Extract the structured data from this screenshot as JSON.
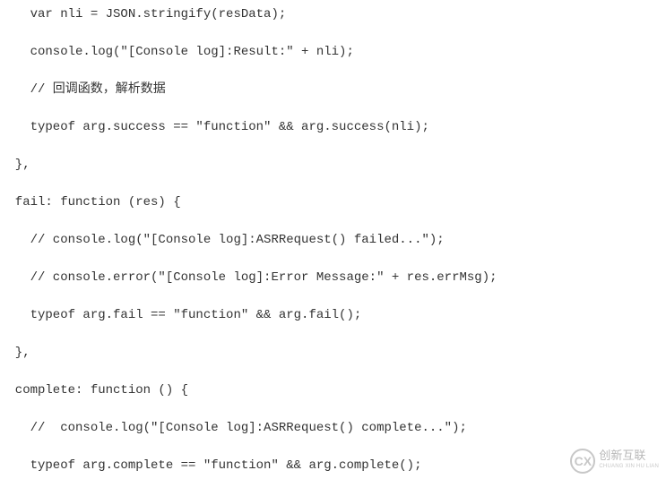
{
  "code": {
    "lines": [
      "    var nli = JSON.stringify(resData);",
      "",
      "    console.log(\"[Console log]:Result:\" + nli);",
      "",
      "    // 回调函数，解析数据",
      "",
      "    typeof arg.success == \"function\" && arg.success(nli);",
      "",
      "  },",
      "",
      "  fail: function (res) {",
      "",
      "    // console.log(\"[Console log]:ASRRequest() failed...\");",
      "",
      "    // console.error(\"[Console log]:Error Message:\" + res.errMsg);",
      "",
      "    typeof arg.fail == \"function\" && arg.fail();",
      "",
      "  },",
      "",
      "  complete: function () {",
      "",
      "    //  console.log(\"[Console log]:ASRRequest() complete...\");",
      "",
      "    typeof arg.complete == \"function\" && arg.complete();"
    ]
  },
  "watermark": {
    "icon_letters": "CX",
    "main": "创新互联",
    "sub": "CHUANG XIN HU LIAN"
  }
}
